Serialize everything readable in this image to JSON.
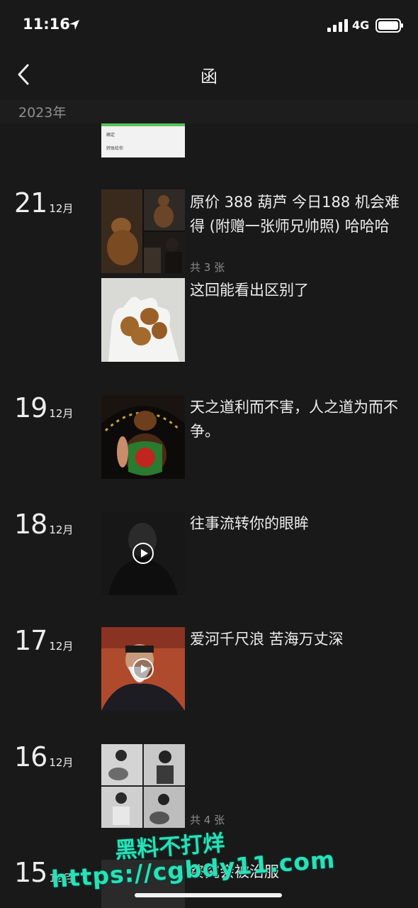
{
  "status_bar": {
    "time": "11:16",
    "network": "4G"
  },
  "nav": {
    "title": "函"
  },
  "year_header": "2023年",
  "top_thumb_lines": [
    "确定",
    "转账给你"
  ],
  "posts": [
    {
      "day": "21",
      "month": "12月",
      "text": "原价 388 葫芦  今日188 机会难得 (附赠一张师兄帅照) 哈哈哈",
      "count": "共 3 张",
      "text2": "这回能看出区别了"
    },
    {
      "day": "19",
      "month": "12月",
      "text": "天之道利而不害，人之道为而不争。"
    },
    {
      "day": "18",
      "month": "12月",
      "text": "往事流转你的眼眸"
    },
    {
      "day": "17",
      "month": "12月",
      "text": "爱河千尺浪 苦海万丈深"
    },
    {
      "day": "16",
      "month": "12月",
      "count": "共 4 张"
    },
    {
      "day": "15",
      "month": "12月",
      "text": "终究会被治服"
    }
  ],
  "watermark": {
    "line1": "黑料不打烊",
    "line2": "https://cgbdy11.com"
  }
}
